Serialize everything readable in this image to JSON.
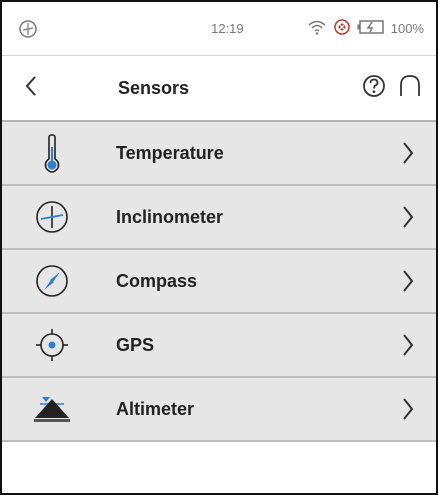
{
  "status": {
    "time": "12:19",
    "battery": "100%",
    "icons": [
      "inclinometer-status-icon",
      "wifi-icon",
      "alarm-icon",
      "battery-charging-icon"
    ]
  },
  "header": {
    "title": "Sensors",
    "back_icon": "chevron-left-icon",
    "help_icon": "help-icon",
    "home_icon": "home-icon"
  },
  "items": [
    {
      "label": "Temperature",
      "icon": "thermometer-icon"
    },
    {
      "label": "Inclinometer",
      "icon": "inclinometer-icon"
    },
    {
      "label": "Compass",
      "icon": "compass-icon"
    },
    {
      "label": "GPS",
      "icon": "gps-icon"
    },
    {
      "label": "Altimeter",
      "icon": "altimeter-icon"
    }
  ],
  "colors": {
    "accent": "#2e7fd1",
    "row_bg": "#e6e6e6",
    "separator": "#bdbdbd"
  }
}
